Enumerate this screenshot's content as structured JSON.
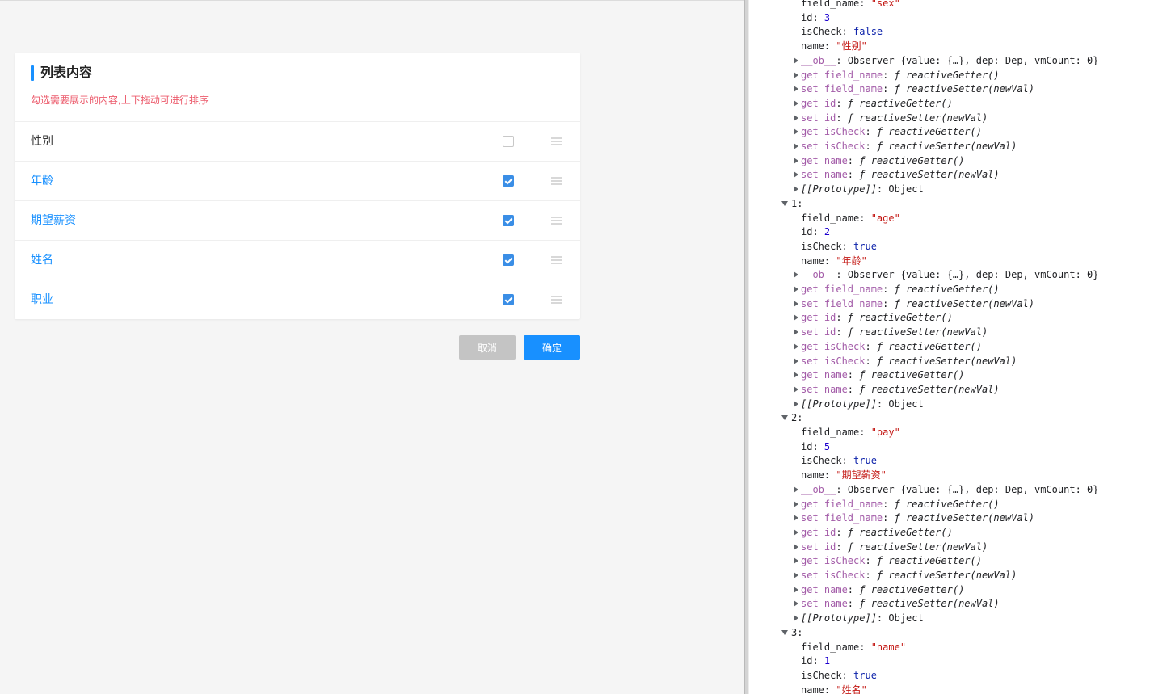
{
  "panel": {
    "title": "列表内容",
    "subtitle": "勾选需要展示的内容,上下拖动可进行排序",
    "items": [
      {
        "label": "性别",
        "checked": false
      },
      {
        "label": "年龄",
        "checked": true
      },
      {
        "label": "期望薪资",
        "checked": true
      },
      {
        "label": "姓名",
        "checked": true
      },
      {
        "label": "职业",
        "checked": true
      }
    ],
    "cancel_label": "取消",
    "confirm_label": "确定"
  },
  "colors": {
    "accent": "#1890ff",
    "subtitle": "#ec5b6c",
    "checkbox_on": "#3a8ee6",
    "cancel_bg": "#c4c4c4"
  },
  "console": {
    "lines": [
      {
        "indent": 2,
        "type": "prop",
        "key": "field_name",
        "value": "\"sex\"",
        "vclass": "str"
      },
      {
        "indent": 2,
        "type": "prop",
        "key": "id",
        "value": "3",
        "vclass": "num"
      },
      {
        "indent": 2,
        "type": "prop",
        "key": "isCheck",
        "value": "false",
        "vclass": "bool"
      },
      {
        "indent": 2,
        "type": "prop",
        "key": "name",
        "value": "\"性别\"",
        "vclass": "str"
      },
      {
        "indent": 1,
        "type": "obs",
        "key": "__ob__",
        "value": "Observer {value: {…}, dep: Dep, vmCount: 0}"
      },
      {
        "indent": 1,
        "type": "acc",
        "key": "get field_name",
        "value": "reactiveGetter()"
      },
      {
        "indent": 1,
        "type": "acc",
        "key": "set field_name",
        "value": "reactiveSetter(newVal)"
      },
      {
        "indent": 1,
        "type": "acc",
        "key": "get id",
        "value": "reactiveGetter()"
      },
      {
        "indent": 1,
        "type": "acc",
        "key": "set id",
        "value": "reactiveSetter(newVal)"
      },
      {
        "indent": 1,
        "type": "acc",
        "key": "get isCheck",
        "value": "reactiveGetter()"
      },
      {
        "indent": 1,
        "type": "acc",
        "key": "set isCheck",
        "value": "reactiveSetter(newVal)"
      },
      {
        "indent": 1,
        "type": "acc",
        "key": "get name",
        "value": "reactiveGetter()"
      },
      {
        "indent": 1,
        "type": "acc",
        "key": "set name",
        "value": "reactiveSetter(newVal)"
      },
      {
        "indent": 1,
        "type": "proto",
        "key": "[[Prototype]]",
        "value": "Object"
      },
      {
        "indent": 0,
        "type": "idx",
        "key": "1"
      },
      {
        "indent": 2,
        "type": "prop",
        "key": "field_name",
        "value": "\"age\"",
        "vclass": "str"
      },
      {
        "indent": 2,
        "type": "prop",
        "key": "id",
        "value": "2",
        "vclass": "num"
      },
      {
        "indent": 2,
        "type": "prop",
        "key": "isCheck",
        "value": "true",
        "vclass": "bool"
      },
      {
        "indent": 2,
        "type": "prop",
        "key": "name",
        "value": "\"年龄\"",
        "vclass": "str"
      },
      {
        "indent": 1,
        "type": "obs",
        "key": "__ob__",
        "value": "Observer {value: {…}, dep: Dep, vmCount: 0}"
      },
      {
        "indent": 1,
        "type": "acc",
        "key": "get field_name",
        "value": "reactiveGetter()"
      },
      {
        "indent": 1,
        "type": "acc",
        "key": "set field_name",
        "value": "reactiveSetter(newVal)"
      },
      {
        "indent": 1,
        "type": "acc",
        "key": "get id",
        "value": "reactiveGetter()"
      },
      {
        "indent": 1,
        "type": "acc",
        "key": "set id",
        "value": "reactiveSetter(newVal)"
      },
      {
        "indent": 1,
        "type": "acc",
        "key": "get isCheck",
        "value": "reactiveGetter()"
      },
      {
        "indent": 1,
        "type": "acc",
        "key": "set isCheck",
        "value": "reactiveSetter(newVal)"
      },
      {
        "indent": 1,
        "type": "acc",
        "key": "get name",
        "value": "reactiveGetter()"
      },
      {
        "indent": 1,
        "type": "acc",
        "key": "set name",
        "value": "reactiveSetter(newVal)"
      },
      {
        "indent": 1,
        "type": "proto",
        "key": "[[Prototype]]",
        "value": "Object"
      },
      {
        "indent": 0,
        "type": "idx",
        "key": "2"
      },
      {
        "indent": 2,
        "type": "prop",
        "key": "field_name",
        "value": "\"pay\"",
        "vclass": "str"
      },
      {
        "indent": 2,
        "type": "prop",
        "key": "id",
        "value": "5",
        "vclass": "num"
      },
      {
        "indent": 2,
        "type": "prop",
        "key": "isCheck",
        "value": "true",
        "vclass": "bool"
      },
      {
        "indent": 2,
        "type": "prop",
        "key": "name",
        "value": "\"期望薪资\"",
        "vclass": "str"
      },
      {
        "indent": 1,
        "type": "obs",
        "key": "__ob__",
        "value": "Observer {value: {…}, dep: Dep, vmCount: 0}"
      },
      {
        "indent": 1,
        "type": "acc",
        "key": "get field_name",
        "value": "reactiveGetter()"
      },
      {
        "indent": 1,
        "type": "acc",
        "key": "set field_name",
        "value": "reactiveSetter(newVal)"
      },
      {
        "indent": 1,
        "type": "acc",
        "key": "get id",
        "value": "reactiveGetter()"
      },
      {
        "indent": 1,
        "type": "acc",
        "key": "set id",
        "value": "reactiveSetter(newVal)"
      },
      {
        "indent": 1,
        "type": "acc",
        "key": "get isCheck",
        "value": "reactiveGetter()"
      },
      {
        "indent": 1,
        "type": "acc",
        "key": "set isCheck",
        "value": "reactiveSetter(newVal)"
      },
      {
        "indent": 1,
        "type": "acc",
        "key": "get name",
        "value": "reactiveGetter()"
      },
      {
        "indent": 1,
        "type": "acc",
        "key": "set name",
        "value": "reactiveSetter(newVal)"
      },
      {
        "indent": 1,
        "type": "proto",
        "key": "[[Prototype]]",
        "value": "Object"
      },
      {
        "indent": 0,
        "type": "idx",
        "key": "3"
      },
      {
        "indent": 2,
        "type": "prop",
        "key": "field_name",
        "value": "\"name\"",
        "vclass": "str"
      },
      {
        "indent": 2,
        "type": "prop",
        "key": "id",
        "value": "1",
        "vclass": "num"
      },
      {
        "indent": 2,
        "type": "prop",
        "key": "isCheck",
        "value": "true",
        "vclass": "bool"
      },
      {
        "indent": 2,
        "type": "prop",
        "key": "name",
        "value": "\"姓名\"",
        "vclass": "str"
      }
    ]
  }
}
